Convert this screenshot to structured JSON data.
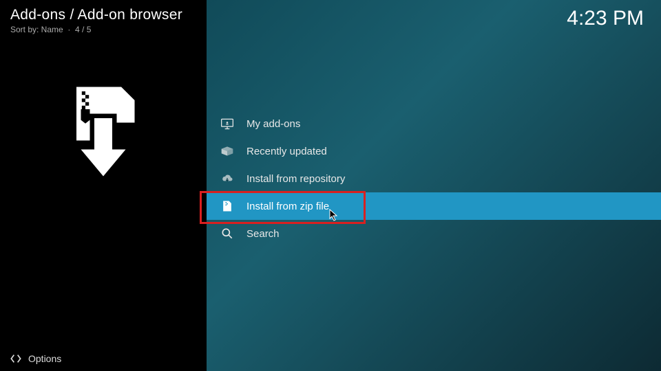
{
  "header": {
    "title": "Add-ons / Add-on browser",
    "sort_label": "Sort by: Name",
    "position": "4 / 5"
  },
  "clock": "4:23 PM",
  "menu": [
    {
      "label": "My add-ons"
    },
    {
      "label": "Recently updated"
    },
    {
      "label": "Install from repository"
    },
    {
      "label": "Install from zip file"
    },
    {
      "label": "Search"
    }
  ],
  "footer": {
    "options_label": "Options"
  }
}
